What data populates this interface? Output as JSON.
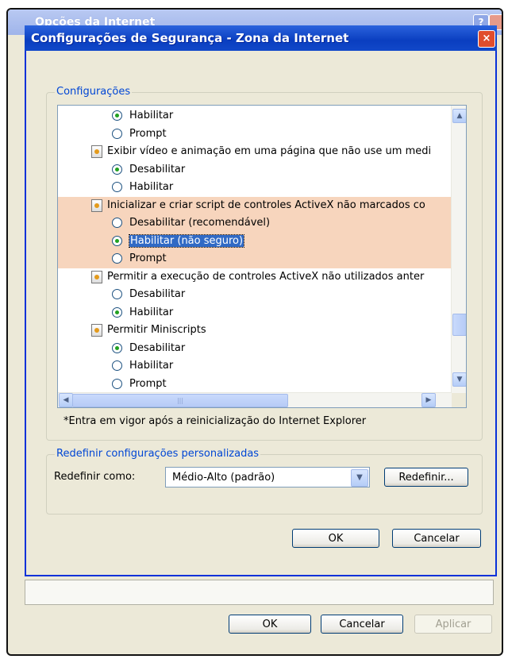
{
  "back_window": {
    "title": "Opções da Internet",
    "help_label": "?",
    "buttons": {
      "ok": "OK",
      "cancel": "Cancelar",
      "apply": "Aplicar"
    }
  },
  "dialog": {
    "title": "Configurações de Segurança - Zona da Internet",
    "close_label": "×",
    "settings_group_label": "Configurações",
    "note": "*Entra em vigor após a reinicialização do Internet Explorer",
    "reset_group_label": "Redefinir configurações personalizadas",
    "reset_as_label": "Redefinir como:",
    "reset_level_value": "Médio-Alto (padrão)",
    "reset_button": "Redefinir...",
    "ok_button": "OK",
    "cancel_button": "Cancelar"
  },
  "settings_rows": [
    {
      "kind": "option",
      "label": "Habilitar",
      "checked": true
    },
    {
      "kind": "option",
      "label": "Prompt",
      "checked": false
    },
    {
      "kind": "setting",
      "label": "Exibir vídeo e animação em uma página que não use um medi"
    },
    {
      "kind": "option",
      "label": "Desabilitar",
      "checked": true
    },
    {
      "kind": "option",
      "label": "Habilitar",
      "checked": false
    },
    {
      "kind": "setting",
      "label": "Inicializar e criar script de controles ActiveX não marcados co",
      "highlight": true
    },
    {
      "kind": "option",
      "label": "Desabilitar (recomendável)",
      "checked": false,
      "highlight": true
    },
    {
      "kind": "option",
      "label": "Habilitar (não seguro)",
      "checked": true,
      "highlight": true,
      "selected": true
    },
    {
      "kind": "option",
      "label": "Prompt",
      "checked": false,
      "highlight": true
    },
    {
      "kind": "setting",
      "label": "Permitir a execução de controles ActiveX não utilizados anter"
    },
    {
      "kind": "option",
      "label": "Desabilitar",
      "checked": false
    },
    {
      "kind": "option",
      "label": "Habilitar",
      "checked": true
    },
    {
      "kind": "setting",
      "label": "Permitir Miniscripts"
    },
    {
      "kind": "option",
      "label": "Desabilitar",
      "checked": true
    },
    {
      "kind": "option",
      "label": "Habilitar",
      "checked": false
    },
    {
      "kind": "option",
      "label": "Prompt",
      "checked": false
    }
  ]
}
